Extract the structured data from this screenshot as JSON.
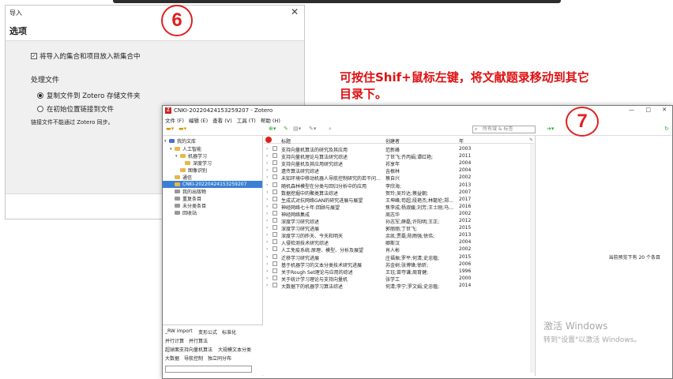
{
  "dialog": {
    "title": "导入",
    "heading": "选项",
    "checkbox_label": "将导入的集合和项目放入新集合中",
    "section_label": "处理文件",
    "radio1": "复制文件到 Zotero 存储文件夹",
    "radio2": "在初始位置链接到文件",
    "note": "链接文件不能通过 Zotero 同步。"
  },
  "step6": "6",
  "step7": "7",
  "annotation": {
    "line1": "可按住Shif+鼠标左键，将文献题录移动到其它",
    "line2": "目录下。"
  },
  "zotero": {
    "title": "CNKI-20220424153259207 - Zotero",
    "menus": [
      "文件 (F)",
      "编辑 (E)",
      "查看 (V)",
      "工具 (T)",
      "帮助 (H)"
    ],
    "search_placeholder": "所有域 & 标签",
    "tree": [
      {
        "label": "我的文库",
        "indent": 0,
        "color": "blue"
      },
      {
        "label": "人工智能",
        "indent": 1,
        "color": "yellow"
      },
      {
        "label": "机器学习",
        "indent": 2,
        "color": "yellow"
      },
      {
        "label": "深度学习",
        "indent": 3,
        "color": "yellow"
      },
      {
        "label": "图像识别",
        "indent": 2,
        "color": "yellow"
      },
      {
        "label": "通信",
        "indent": 1,
        "color": "yellow"
      },
      {
        "label": "CNKI-20220424153259207",
        "indent": 1,
        "color": "yellow",
        "selected": true
      },
      {
        "label": "我的出版物",
        "indent": 1,
        "color": "gray"
      },
      {
        "label": "重复条目",
        "indent": 1,
        "color": "gray"
      },
      {
        "label": "未分类条目",
        "indent": 1,
        "color": "gray"
      },
      {
        "label": "回收站",
        "indent": 1,
        "color": "gray"
      }
    ],
    "tags": [
      [
        "_RW import",
        "变形公式",
        "标准化"
      ],
      [
        "并行计算",
        "并行算法"
      ],
      [
        "超球面支持向量机算法",
        "大规模文本分类"
      ],
      [
        "大数据",
        "导航控制",
        "独立同分布"
      ]
    ],
    "columns": {
      "title": "标题",
      "creator": "创建者",
      "year": "年"
    },
    "items": [
      {
        "title": "支持向量机算法的研究及其应用",
        "creator": "范新峰",
        "year": "2003"
      },
      {
        "title": "支持向量机理论与算法研究综述",
        "creator": "丁世飞;齐丙娟;谭红艳;",
        "year": "2011"
      },
      {
        "title": "支持向量机及其应用研究综述",
        "creator": "祁享年",
        "year": "2004"
      },
      {
        "title": "遗传算法研究综述",
        "creator": "吉根林",
        "year": "2004"
      },
      {
        "title": "未知环境中移动机器人导航控制研究的若干问…",
        "creator": "蔡自兴",
        "year": "2002"
      },
      {
        "title": "随机森林模型在分类与回归分析中的应用",
        "creator": "李欣海;",
        "year": "2013"
      },
      {
        "title": "数据挖掘中的聚类算法综述",
        "creator": "贺玲;吴玲达;蔡益朝;",
        "year": "2007"
      },
      {
        "title": "生成式对抗网络GAN的研究进展与展望",
        "creator": "王坤峰;苟超;段艳杰;林懿伦;郑…",
        "year": "2017"
      },
      {
        "title": "神经网络七十年:回顾与展望",
        "creator": "焦李成;杨淑媛;刘芳;王士刚;马…",
        "year": "2016"
      },
      {
        "title": "神经网络集成",
        "creator": "周志华",
        "year": "2002"
      },
      {
        "title": "深度学习研究综述",
        "creator": "孙志军;薛磊;许阳明;王正;",
        "year": "2012"
      },
      {
        "title": "深度学习研究进展",
        "creator": "郭丽丽;丁世飞;",
        "year": "2015"
      },
      {
        "title": "深度学习的昨天、今天和明天",
        "creator": "余凯;贾磊;陈雨强;徐伟;",
        "year": "2013"
      },
      {
        "title": "入侵检测技术研究综述",
        "creator": "卿斯汉",
        "year": "2004"
      },
      {
        "title": "人工免疫系统:原理、模型、分析及展望",
        "creator": "肖人彬",
        "year": "2002"
      },
      {
        "title": "迁移学习研究进展",
        "creator": "庄福振;罗平;何清;史忠植;",
        "year": "2015"
      },
      {
        "title": "基于机器学习的文本分类技术研究进展",
        "creator": "苏金树;张博锋;徐昕;",
        "year": "2006"
      },
      {
        "title": "关于Rough Set理论与应用的综述",
        "creator": "王珏;苗夺谦;周育健;",
        "year": "1996"
      },
      {
        "title": "关于统计学习理论与支持向量机",
        "creator": "张学工",
        "year": "2000"
      },
      {
        "title": "大数据下的机器学习算法综述",
        "creator": "何清;李宁;罗文娟;史忠植;",
        "year": "2014"
      }
    ],
    "right_status": "当前预览下有 20 个条目"
  },
  "watermark": {
    "line1": "激活 Windows",
    "line2": "转到\"设置\"以激活 Windows。"
  }
}
